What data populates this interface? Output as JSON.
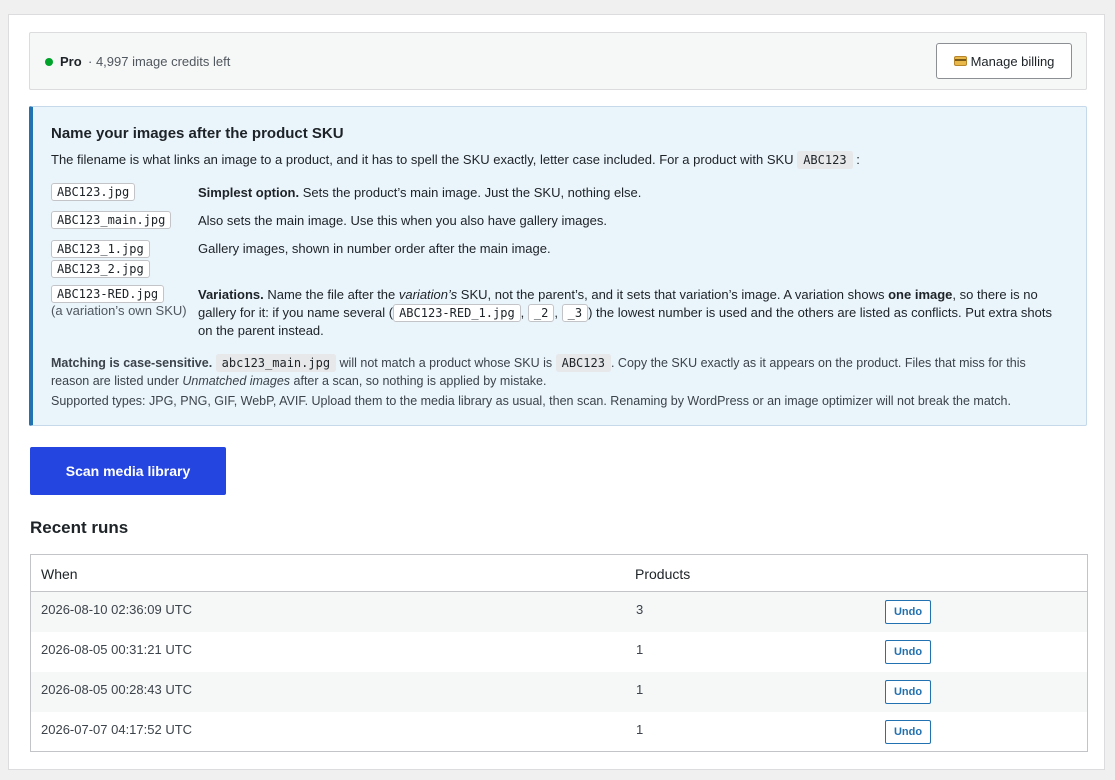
{
  "plan": {
    "name": "Pro",
    "credits": "· 4,997 image credits left",
    "billing_label": "Manage billing"
  },
  "info": {
    "title": "Name your images after the product SKU",
    "lead_text": "The filename is what links an image to a product, and it has to spell the SKU exactly, letter case included. For a product with SKU",
    "lead_sku": "ABC123",
    "lead_end": ":",
    "rows": [
      {
        "file": "ABC123.jpg",
        "strong": "Simplest option.",
        "text": " Sets the product’s main image. Just the SKU, nothing else."
      },
      {
        "file": "ABC123_main.jpg",
        "text": "Also sets the main image. Use this when you also have gallery images."
      },
      {
        "files": [
          "ABC123_1.jpg",
          "ABC123_2.jpg"
        ],
        "text": "Gallery images, shown in number order after the main image."
      },
      {
        "file": "ABC123-RED.jpg",
        "sub": "(a variation’s own SKU)",
        "strong": "Variations.",
        "t1": " Name the file after the ",
        "em": "variation’s",
        "t2": " SKU, not the parent’s, and it sets that variation’s image. A variation shows ",
        "strong2": "one image",
        "t3": ", so there is no gallery for it: if you name several (",
        "c1": "ABC123-RED_1.jpg",
        "sep1": ",",
        "c2": "_2",
        "sep2": ",",
        "c3": "_3",
        "t4": ") the lowest number is used and the others are listed as conflicts. Put extra shots on the parent instead."
      }
    ],
    "case": {
      "strong": "Matching is case-sensitive.",
      "code1": "abc123_main.jpg",
      "t1": "will not match a product whose SKU is",
      "code2": "ABC123",
      "t2": ". Copy the SKU exactly as it appears on the product. Files that miss for this reason are listed under",
      "em": "Unmatched images",
      "t3": "after a scan, so nothing is applied by mistake."
    },
    "supported": "Supported types: JPG, PNG, GIF, WebP, AVIF. Upload them to the media library as usual, then scan. Renaming by WordPress or an image optimizer will not break the match."
  },
  "scan_label": "Scan media library",
  "recent": {
    "title": "Recent runs",
    "col_when": "When",
    "col_products": "Products",
    "undo_label": "Undo",
    "rows": [
      {
        "when": "2026-08-10 02:36:09 UTC",
        "products": "3"
      },
      {
        "when": "2026-08-05 00:31:21 UTC",
        "products": "1"
      },
      {
        "when": "2026-08-05 00:28:43 UTC",
        "products": "1"
      },
      {
        "when": "2026-07-07 04:17:52 UTC",
        "products": "1"
      }
    ]
  }
}
